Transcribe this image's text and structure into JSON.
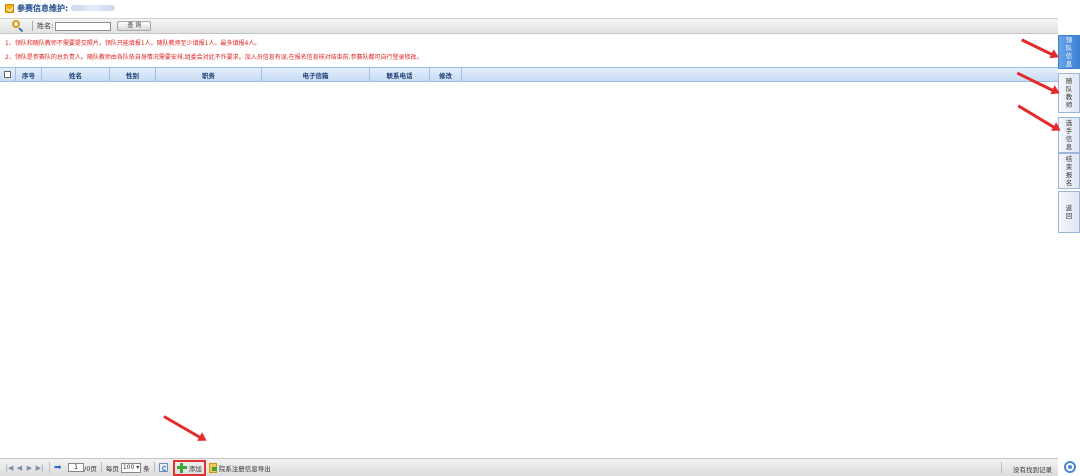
{
  "header": {
    "title": "参赛信息维护:"
  },
  "search": {
    "name_label": "姓名:",
    "name_value": "",
    "query_button": "查 询"
  },
  "notices": [
    "1、领队和随队教师不需要提交照片。领队只能填报1人。随队教师至少填报1人。最多填报4人。",
    "2、领队是参赛队的总负责人。随队教师由各队依自身情况需要安排,组委会对此不作要求。加入员信息有误,在报名信息核对结束前,参赛队都可自行登录修改。"
  ],
  "table": {
    "columns": [
      "序号",
      "姓名",
      "性别",
      "职务",
      "电子信箱",
      "联系电话",
      "修改"
    ]
  },
  "side_tabs": [
    {
      "label": "领队信息",
      "active": true
    },
    {
      "label": "随队教师",
      "active": false
    },
    {
      "label": "选手信息",
      "active": false
    },
    {
      "label": "结束报名",
      "active": false
    },
    {
      "label": "返回",
      "active": false
    }
  ],
  "pagination": {
    "first": "|◀",
    "prev": "◀",
    "next": "▶",
    "last": "▶|",
    "page_value": "1",
    "page_total": "/0页",
    "per_page_label": "每页",
    "per_page_value": "100",
    "per_page_unit": "条"
  },
  "actions": {
    "add": "添加",
    "export": "院系注册信息导出"
  },
  "status": {
    "no_record": "没有找到记录"
  },
  "colors": {
    "accent": "#3d7fd1",
    "notice": "#e02020",
    "highlight": "#e23030"
  }
}
